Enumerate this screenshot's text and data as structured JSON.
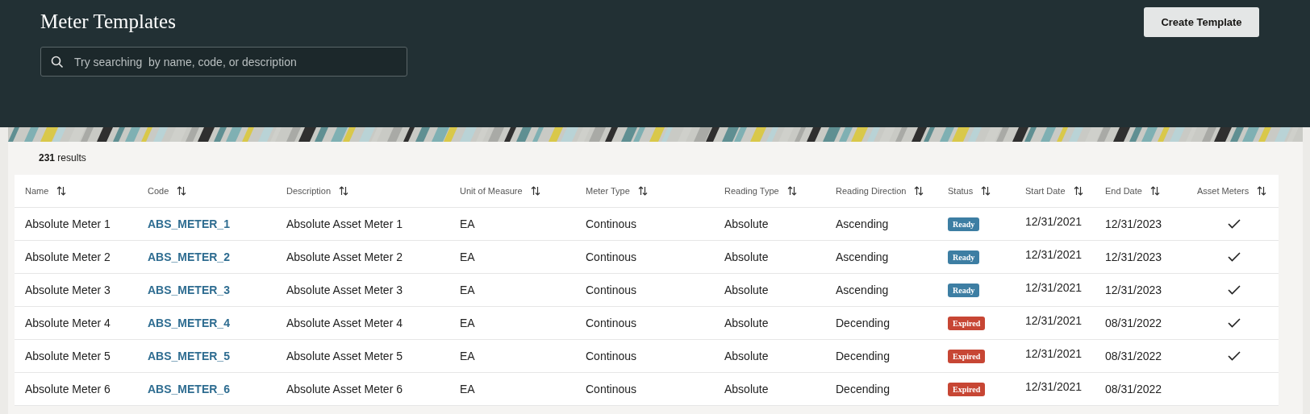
{
  "header": {
    "title": "Meter Templates",
    "search": {
      "placeholder": "Try searching  by name, code, or description"
    },
    "create_button": "Create Template"
  },
  "results": {
    "count": "231",
    "label": "results"
  },
  "table": {
    "columns": [
      "Name",
      "Code",
      "Description",
      "Unit of Measure",
      "Meter Type",
      "Reading Type",
      "Reading Direction",
      "Status",
      "Start Date",
      "End Date",
      "Asset Meters"
    ],
    "rows": [
      {
        "name": "Absolute Meter 1",
        "code": "ABS_METER_1",
        "description": "Absolute Asset Meter 1",
        "unit": "EA",
        "meter_type": "Continous",
        "reading_type": "Absolute",
        "direction": "Ascending",
        "status": {
          "label": "Ready",
          "color": "#3d7ea3"
        },
        "start_date": "12/31/2021",
        "end_date": "12/31/2023",
        "asset_meters": true
      },
      {
        "name": "Absolute Meter 2",
        "code": "ABS_METER_2",
        "description": "Absolute Asset Meter 2",
        "unit": "EA",
        "meter_type": "Continous",
        "reading_type": "Absolute",
        "direction": "Ascending",
        "status": {
          "label": "Ready",
          "color": "#3d7ea3"
        },
        "start_date": "12/31/2021",
        "end_date": "12/31/2023",
        "asset_meters": true
      },
      {
        "name": "Absolute Meter 3",
        "code": "ABS_METER_3",
        "description": "Absolute Asset Meter 3",
        "unit": "EA",
        "meter_type": "Continous",
        "reading_type": "Absolute",
        "direction": "Ascending",
        "status": {
          "label": "Ready",
          "color": "#3d7ea3"
        },
        "start_date": "12/31/2021",
        "end_date": "12/31/2023",
        "asset_meters": true
      },
      {
        "name": "Absolute Meter 4",
        "code": "ABS_METER_4",
        "description": "Absolute Asset Meter 4",
        "unit": "EA",
        "meter_type": "Continous",
        "reading_type": "Absolute",
        "direction": "Decending",
        "status": {
          "label": "Expired",
          "color": "#c74634"
        },
        "start_date": "12/31/2021",
        "end_date": "08/31/2022",
        "asset_meters": true
      },
      {
        "name": "Absolute Meter 5",
        "code": "ABS_METER_5",
        "description": "Absolute Asset Meter 5",
        "unit": "EA",
        "meter_type": "Continous",
        "reading_type": "Absolute",
        "direction": "Decending",
        "status": {
          "label": "Expired",
          "color": "#c74634"
        },
        "start_date": "12/31/2021",
        "end_date": "08/31/2022",
        "asset_meters": true
      },
      {
        "name": "Absolute Meter 6",
        "code": "ABS_METER_6",
        "description": "Absolute Asset Meter 6",
        "unit": "EA",
        "meter_type": "Continous",
        "reading_type": "Absolute",
        "direction": "Decending",
        "status": {
          "label": "Expired",
          "color": "#c74634"
        },
        "start_date": "12/31/2021",
        "end_date": "08/31/2022",
        "asset_meters": false
      }
    ]
  }
}
